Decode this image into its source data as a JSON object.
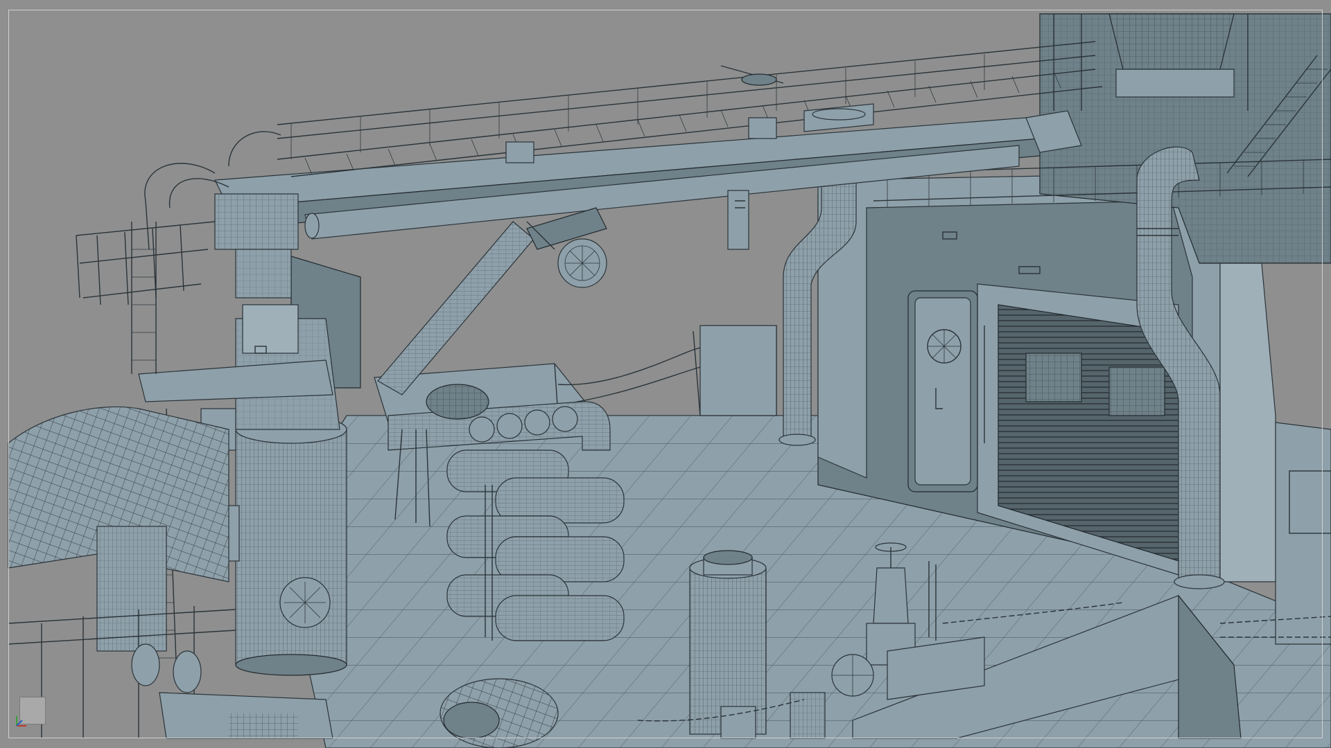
{
  "viewport": {
    "background": "#8f8f8f",
    "mesh_fill": "#8ea0aa",
    "mesh_shadow": "#6f8189",
    "wire_color": "#2a3338",
    "display_mode": "shaded-with-wireframe"
  },
  "scene": {
    "subject": "ship-deck-crane-3d-model",
    "objects": [
      "gantry-crane-beam",
      "crane-pedestal",
      "crane-boom-arm",
      "exhaust-pipe-left",
      "exhaust-pipe-right",
      "deckhouse",
      "watertight-door",
      "roller-shutter-door",
      "gas-cylinder-rack",
      "bollard",
      "gate-valve",
      "deck-railing",
      "anchor-chain",
      "ladder",
      "cargo-net"
    ]
  },
  "gizmo": {
    "icon": "view-cube-icon",
    "axes": [
      "x",
      "y",
      "z"
    ],
    "axis_colors": {
      "x": "#c0392b",
      "y": "#3aa03a",
      "z": "#2c5fbf"
    }
  }
}
